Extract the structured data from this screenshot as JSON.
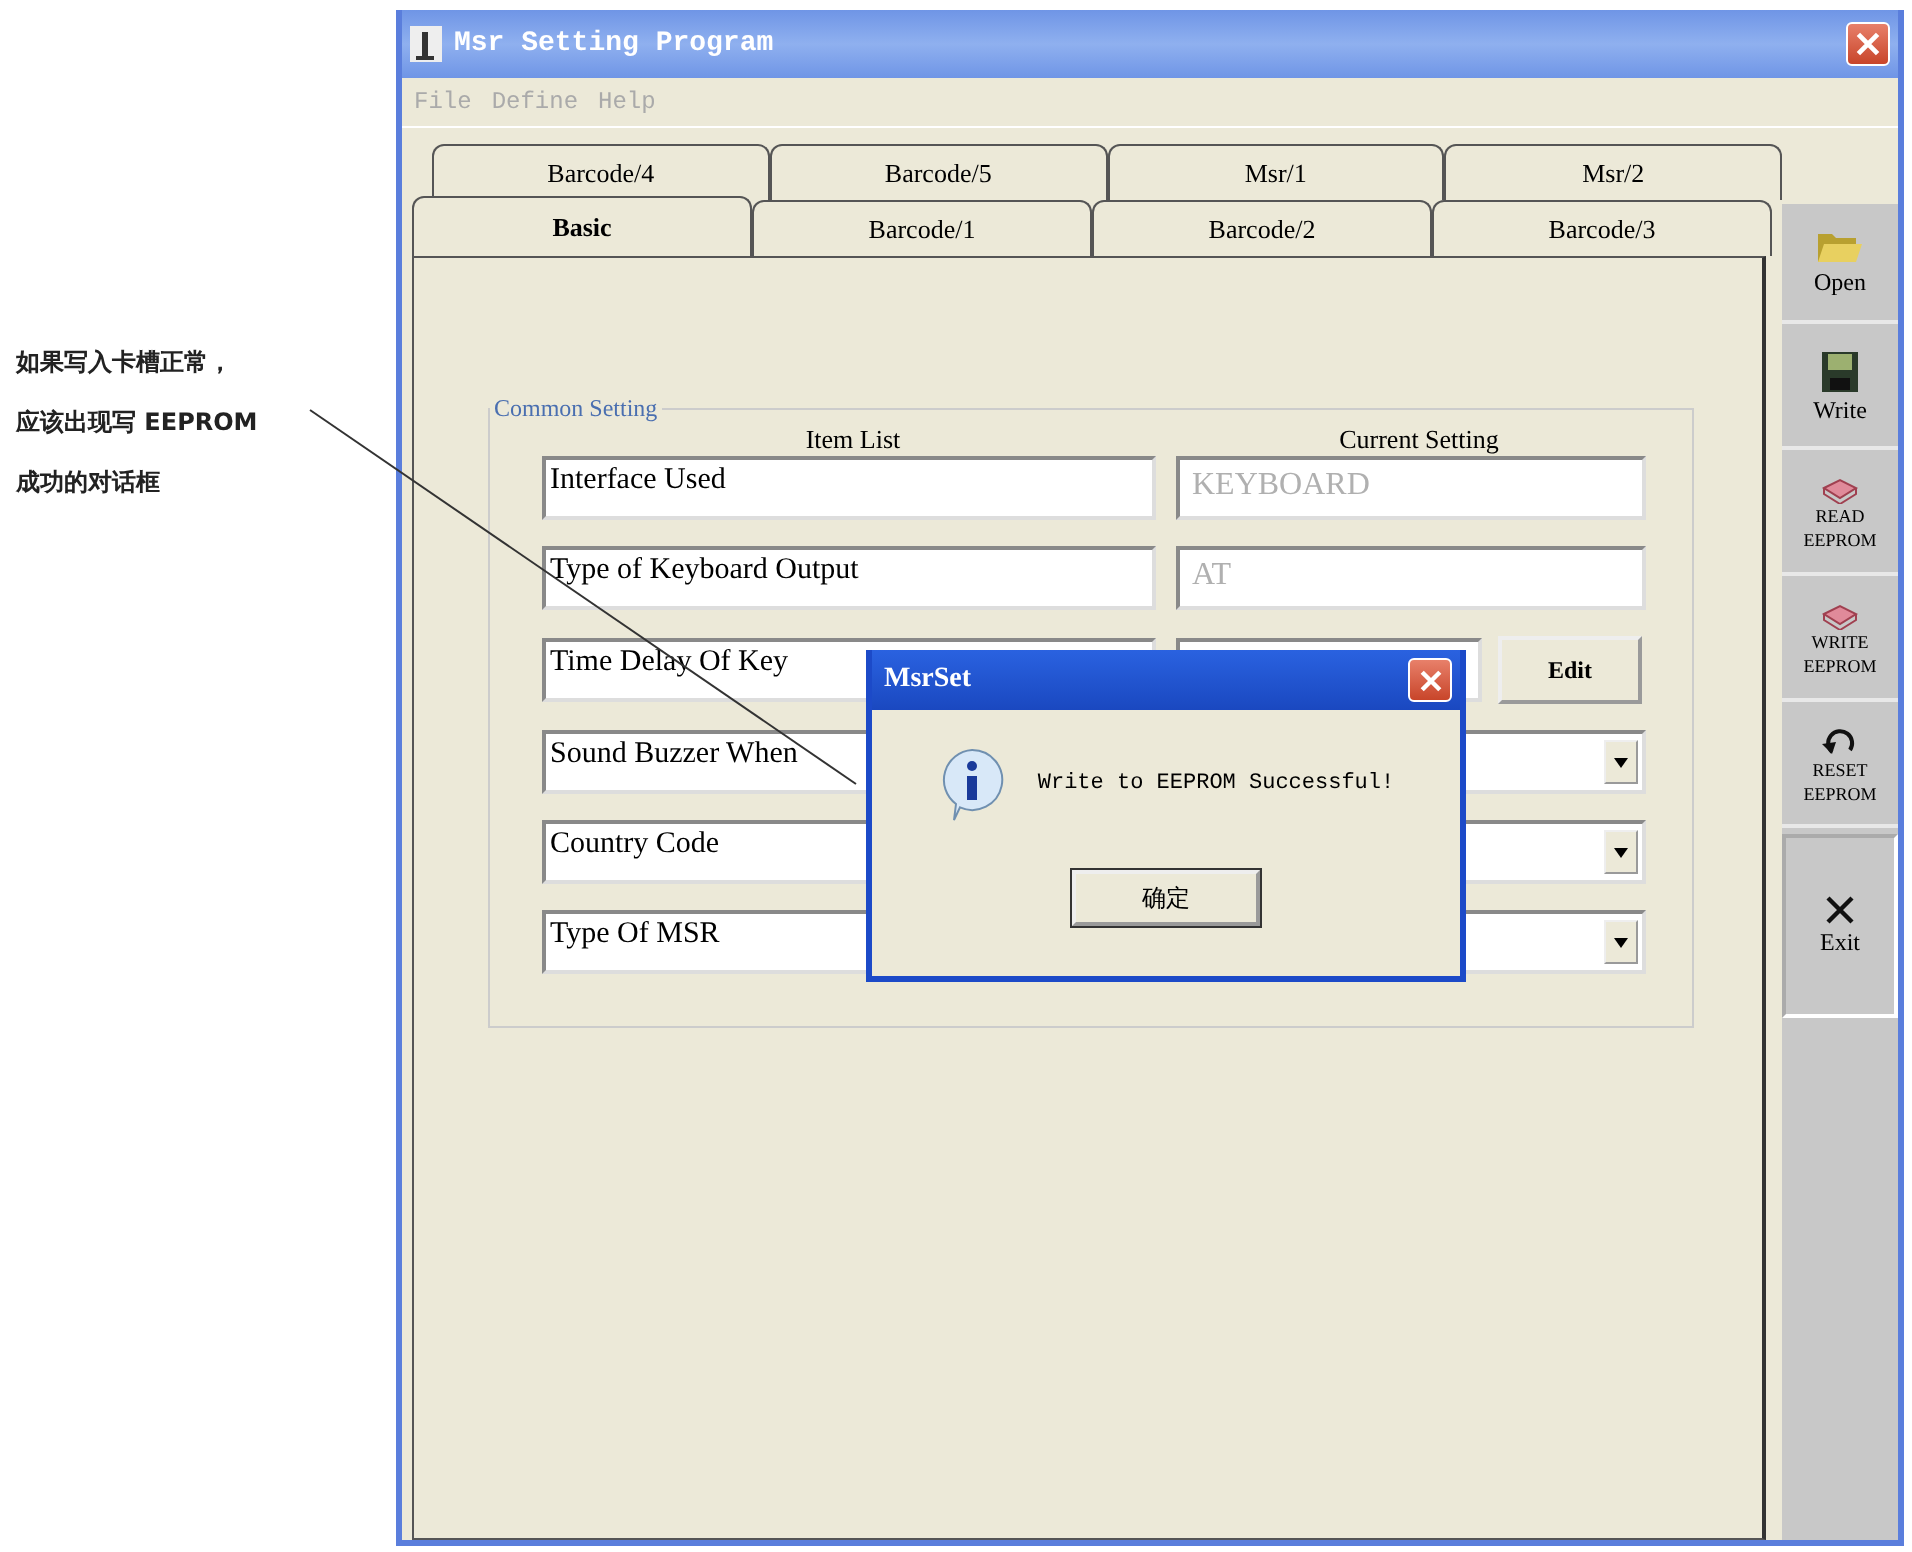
{
  "annotation": {
    "lines": [
      "如果写入卡槽正常，",
      "应该出现写 EEPROM",
      "成功的对话框"
    ]
  },
  "window": {
    "title": "Msr Setting Program"
  },
  "menu": [
    {
      "label": "File",
      "disabled": true
    },
    {
      "label": "Define",
      "disabled": true
    },
    {
      "label": "Help",
      "disabled": true
    }
  ],
  "tabs_back": [
    {
      "label": "Barcode/4",
      "selected": false
    },
    {
      "label": "Barcode/5",
      "selected": false
    },
    {
      "label": "Msr/1",
      "selected": false
    },
    {
      "label": "Msr/2",
      "selected": false
    }
  ],
  "tabs_front": [
    {
      "label": "Basic",
      "selected": true
    },
    {
      "label": "Barcode/1",
      "selected": false
    },
    {
      "label": "Barcode/2",
      "selected": false
    },
    {
      "label": "Barcode/3",
      "selected": false
    }
  ],
  "group": {
    "title": "Common Setting",
    "column_headers": [
      "Item List",
      "Current Setting"
    ],
    "rows": [
      {
        "item": "Interface Used",
        "kind": "text",
        "value": "KEYBOARD"
      },
      {
        "item": "Type of Keyboard Output",
        "kind": "text",
        "value": "AT"
      },
      {
        "item": "Time Delay Of Key",
        "kind": "edit",
        "button": "Edit"
      },
      {
        "item": "Sound Buzzer When",
        "kind": "dropdown"
      },
      {
        "item": "Country Code",
        "kind": "dropdown"
      },
      {
        "item": "Type Of MSR",
        "kind": "dropdown"
      }
    ]
  },
  "toolbar": [
    {
      "kind": "open",
      "lines": [
        "Open"
      ],
      "pressed": false
    },
    {
      "kind": "write",
      "lines": [
        "Write"
      ],
      "pressed": false
    },
    {
      "kind": "chip",
      "lines": [
        "READ",
        "EEPROM"
      ],
      "pressed": false
    },
    {
      "kind": "chip",
      "lines": [
        "WRITE",
        "EEPROM"
      ],
      "pressed": false
    },
    {
      "kind": "reset",
      "lines": [
        "RESET",
        "EEPROM"
      ],
      "pressed": false
    },
    {
      "kind": "exit",
      "lines": [
        "Exit"
      ],
      "pressed": true
    }
  ],
  "dialog": {
    "title": "MsrSet",
    "message": "Write to EEPROM Successful!",
    "button": "确定"
  }
}
